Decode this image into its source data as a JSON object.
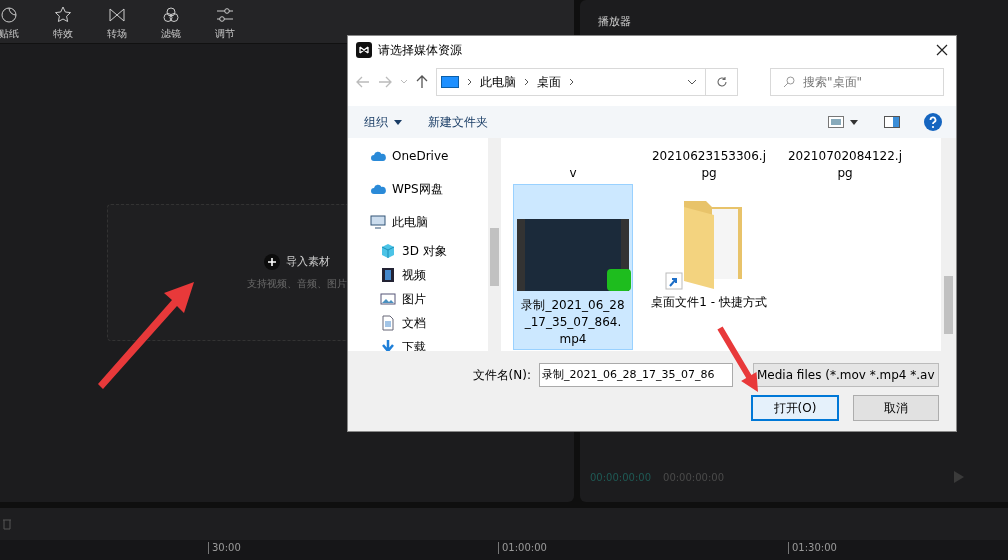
{
  "toolbar": {
    "tools": [
      {
        "label": "贴纸",
        "kind": "sticker"
      },
      {
        "label": "特效",
        "kind": "effect"
      },
      {
        "label": "转场",
        "kind": "transition"
      },
      {
        "label": "滤镜",
        "kind": "filter"
      },
      {
        "label": "调节",
        "kind": "adjust"
      }
    ]
  },
  "media_panel": {
    "import_label": "导入素材",
    "import_hint": "支持视频、音频、图片"
  },
  "player": {
    "title": "播放器",
    "current_time": "00:00:00:00",
    "total_time": "00:00:00:00"
  },
  "timeline": {
    "ruler_labels": [
      "30:00",
      "01:00:00",
      "01:30:00"
    ]
  },
  "dialog": {
    "title": "请选择媒体资源",
    "breadcrumbs": [
      "此电脑",
      "桌面"
    ],
    "search_placeholder": "搜索\"桌面\"",
    "commands": [
      "组织",
      "新建文件夹"
    ],
    "nav_items": [
      {
        "label": "OneDrive",
        "kind": "cloud"
      },
      {
        "label": "WPS网盘",
        "kind": "cloud"
      },
      {
        "label": "此电脑",
        "kind": "computer",
        "children": [
          {
            "label": "3D 对象",
            "kind": "cube"
          },
          {
            "label": "视频",
            "kind": "video"
          },
          {
            "label": "图片",
            "kind": "picture"
          },
          {
            "label": "文档",
            "kind": "document"
          },
          {
            "label": "下载",
            "kind": "download"
          }
        ]
      }
    ],
    "files": [
      {
        "name": "v",
        "kind": "cut",
        "selected": false
      },
      {
        "name": "20210623153306.jpg",
        "kind": "cut",
        "selected": false
      },
      {
        "name": "20210702084122.jpg",
        "kind": "cut",
        "selected": false
      },
      {
        "name": "录制_2021_06_28_17_35_07_864.mp4",
        "kind": "video",
        "selected": true
      },
      {
        "name": "桌面文件1 - 快捷方式",
        "kind": "folder-shortcut",
        "selected": false
      }
    ],
    "filename_label": "文件名(N):",
    "filename_value": "录制_2021_06_28_17_35_07_86",
    "filter": "Media files (*.mov *.mp4 *.av",
    "buttons": [
      "打开(O)",
      "取消"
    ]
  }
}
